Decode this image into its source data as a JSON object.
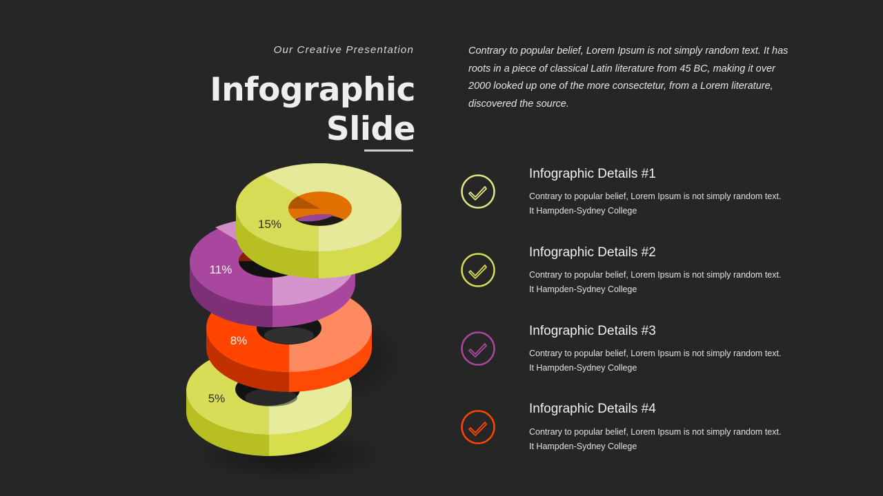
{
  "header": {
    "subtitle": "Our Creative Presentation",
    "title_line1": "Infographic",
    "title_line2": "Slide"
  },
  "intro": "Contrary to popular belief, Lorem Ipsum is not simply random text. It has roots in a piece of classical Latin literature from 45 BC, making it over 2000 looked up one of the more consectetur, from a Lorem literature, discovered the source.",
  "donuts": [
    {
      "label": "5%",
      "color": "#d4dc4e"
    },
    {
      "label": "8%",
      "color": "#ff4500"
    },
    {
      "label": "11%",
      "color": "#a9479f"
    },
    {
      "label": "15%",
      "color": "#d6dc55"
    }
  ],
  "items": [
    {
      "title": "Infographic Details #1",
      "desc": "Contrary to popular belief, Lorem Ipsum is not simply random text. It Hampden-Sydney College",
      "icon": "check-circle-icon",
      "color": "#e3e58a"
    },
    {
      "title": "Infographic Details #2",
      "desc": "Contrary to popular belief, Lorem Ipsum is not simply random text. It Hampden-Sydney College",
      "icon": "check-circle-icon",
      "color": "#d6dc55"
    },
    {
      "title": "Infographic Details #3",
      "desc": "Contrary to popular belief, Lorem Ipsum is not simply random text. It Hampden-Sydney College",
      "icon": "check-circle-icon",
      "color": "#a9479f"
    },
    {
      "title": "Infographic Details #4",
      "desc": "Contrary to popular belief, Lorem Ipsum is not simply random text. It Hampden-Sydney College",
      "icon": "check-circle-icon",
      "color": "#ff4500"
    }
  ]
}
